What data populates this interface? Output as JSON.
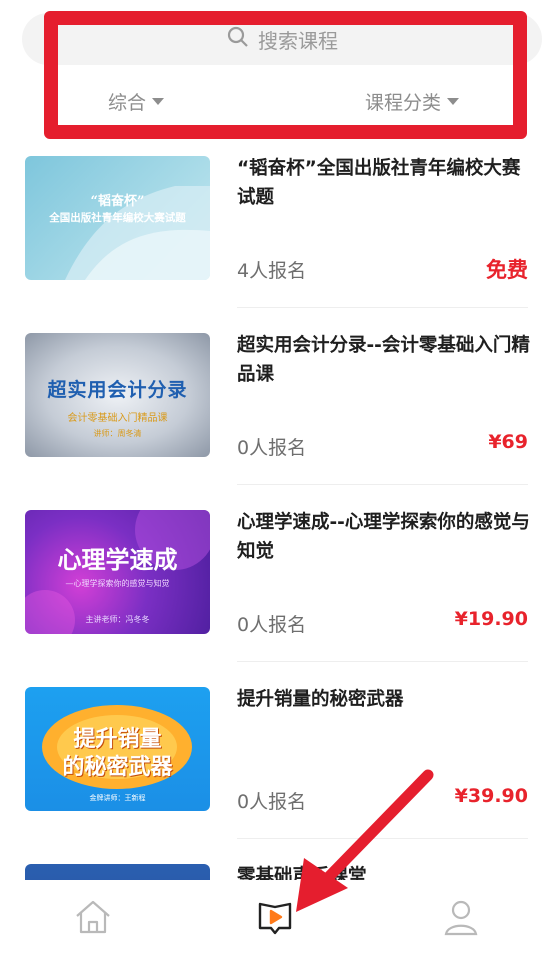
{
  "search": {
    "placeholder": "搜索课程"
  },
  "filters": {
    "sort_label": "综合",
    "category_label": "课程分类"
  },
  "courses": [
    {
      "title": "“韬奋杯”全国出版社青年编校大赛试题",
      "enroll": "4人报名",
      "price": "免费",
      "thumb_line1": "“韬奋杯”",
      "thumb_line2": "全国出版社青年编校大赛试题"
    },
    {
      "title": "超实用会计分录--会计零基础入门精品课",
      "enroll": "0人报名",
      "price": "¥69",
      "thumb_line1": "超实用会计分录",
      "thumb_line2": "会计零基础入门精品课",
      "thumb_line3": "讲师：周冬清"
    },
    {
      "title": "心理学速成--心理学探索你的感觉与知觉",
      "enroll": "0人报名",
      "price": "¥19.90",
      "thumb_line1": "心理学速成",
      "thumb_line2": "—心理学探索你的感觉与知觉",
      "thumb_line3": "主讲老师：冯冬冬"
    },
    {
      "title": "提升销量的秘密武器",
      "enroll": "0人报名",
      "price": "¥39.90",
      "thumb_line1": "提升销量",
      "thumb_line2": "的秘密武器",
      "thumb_line3": "金牌讲师：王新程"
    },
    {
      "title": "零基础声乐课堂"
    }
  ],
  "nav": {
    "home_icon": "home-icon",
    "course_icon": "course-play-icon",
    "profile_icon": "person-icon"
  },
  "colors": {
    "accent": "#e8232c",
    "highlight": "#e51e2e",
    "muted": "#8d8d8d"
  }
}
